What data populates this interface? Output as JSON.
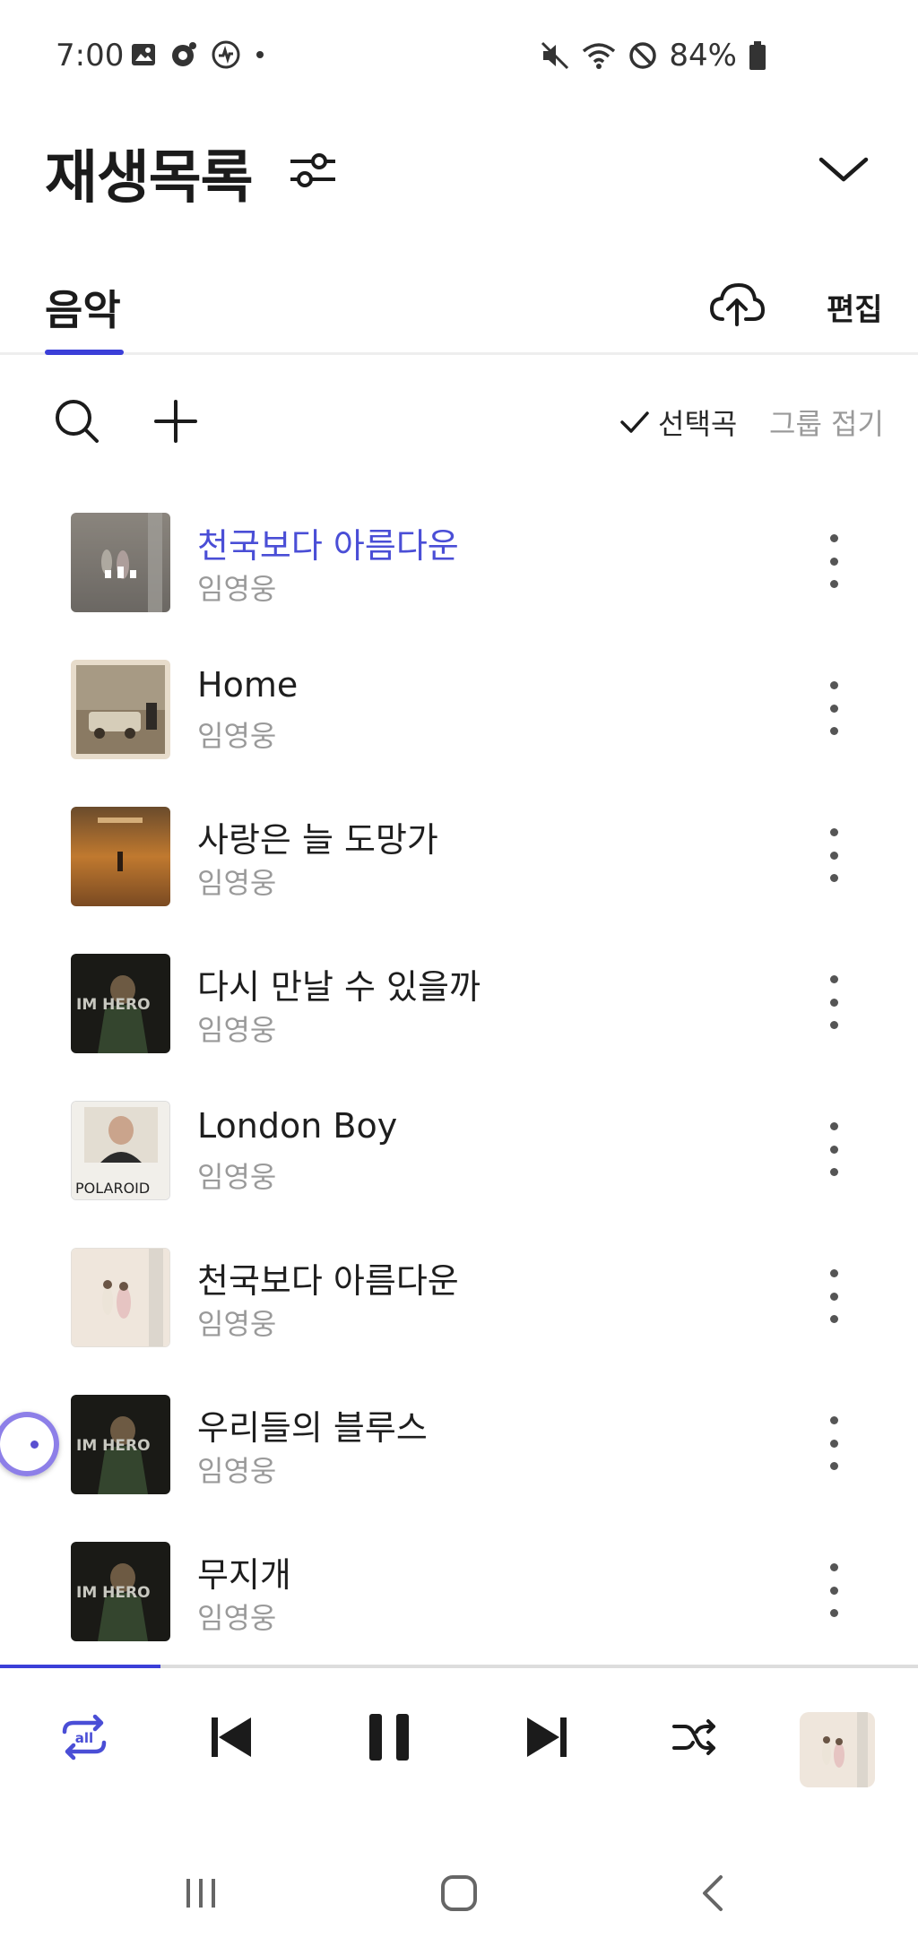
{
  "status_bar": {
    "time": "7:00",
    "battery": "84%",
    "left_icons": [
      "gallery-icon",
      "camera-icon",
      "sync-icon",
      "dot-icon"
    ],
    "right_icons": [
      "mute-icon",
      "wifi-icon",
      "block-icon",
      "battery-icon"
    ]
  },
  "header": {
    "title": "재생목록",
    "filter_icon": "sliders-icon",
    "collapse_icon": "chevron-down-icon"
  },
  "tabs": {
    "music_label": "음악",
    "upload_icon": "cloud-upload-icon",
    "edit_label": "편집"
  },
  "toolbar": {
    "search_icon": "search-icon",
    "add_icon": "plus-icon",
    "selected_label": "선택곡",
    "fold_label": "그룹 접기"
  },
  "songs": [
    {
      "title": "천국보다 아름다운",
      "artist": "임영웅",
      "playing": true,
      "art": "couple"
    },
    {
      "title": "Home",
      "artist": "임영웅",
      "playing": false,
      "art": "car"
    },
    {
      "title": "사랑은 늘 도망가",
      "artist": "임영웅",
      "playing": false,
      "art": "sunset"
    },
    {
      "title": "다시 만날 수 있을까",
      "artist": "임영웅",
      "playing": false,
      "art": "imhero"
    },
    {
      "title": "London Boy",
      "artist": "임영웅",
      "playing": false,
      "art": "polaroid"
    },
    {
      "title": "천국보다 아름다운",
      "artist": "임영웅",
      "playing": false,
      "art": "couple-light"
    },
    {
      "title": "우리들의 블루스",
      "artist": "임영웅",
      "playing": false,
      "art": "imhero"
    },
    {
      "title": "무지개",
      "artist": "임영웅",
      "playing": false,
      "art": "imhero"
    }
  ],
  "album_art_text": {
    "imhero": "IM HERO",
    "polaroid": "POLAROID"
  },
  "player": {
    "progress": 0.175,
    "repeat_label": "all",
    "icons": [
      "repeat-all-icon",
      "previous-icon",
      "pause-icon",
      "next-icon",
      "shuffle-icon"
    ]
  },
  "colors": {
    "accent": "#3b3fd8",
    "playing_title": "#4a4ed6",
    "secondary_text": "#9a9a9a"
  }
}
